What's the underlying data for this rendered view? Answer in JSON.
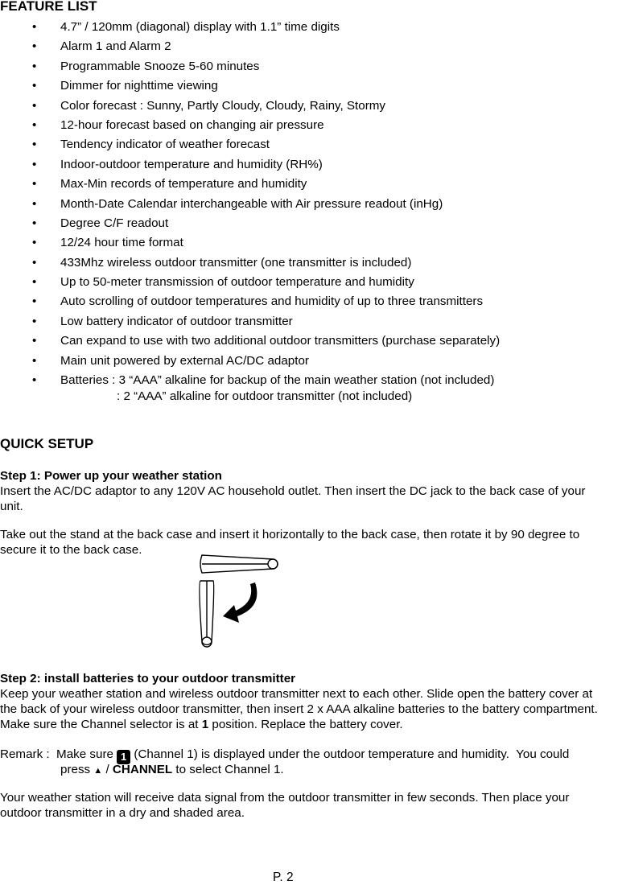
{
  "feature_list": {
    "title": "FEATURE LIST",
    "bullet_glyph": "•",
    "items": [
      "4.7” / 120mm (diagonal) display with 1.1” time digits",
      "Alarm 1 and Alarm 2",
      "Programmable Snooze 5-60 minutes",
      "Dimmer for nighttime viewing",
      "Color forecast : Sunny, Partly Cloudy, Cloudy, Rainy, Stormy",
      "12-hour forecast based on changing air pressure",
      "Tendency indicator of weather forecast",
      "Indoor-outdoor temperature and humidity (RH%)",
      "Max-Min records of temperature and humidity",
      "Month-Date Calendar interchangeable with Air pressure readout (inHg)",
      "Degree C/F readout",
      "12/24 hour time format",
      "433Mhz wireless outdoor transmitter (one transmitter is included)",
      "Up to 50-meter transmission of outdoor temperature and humidity",
      "Auto scrolling of outdoor temperatures and humidity of up to three transmitters",
      "Low battery indicator of outdoor transmitter",
      "Can expand to use with two additional outdoor transmitters (purchase separately)",
      "Main unit powered by external AC/DC adaptor"
    ],
    "batteries": {
      "line1": "Batteries : 3 “AAA” alkaline for backup of the main weather station (not included)",
      "line2": ": 2 “AAA” alkaline for outdoor transmitter (not included)"
    }
  },
  "quick_setup": {
    "title": "QUICK SETUP",
    "step1": {
      "heading": "Step 1: Power up your weather station",
      "para1_line1": "Insert the AC/DC adaptor to any 120V AC household outlet. Then insert the DC jack to the back case of your",
      "para1_line2": "unit.",
      "para2_line1": "Take out the stand at the back case and insert it horizontally to the back case, then rotate it by 90 degree to",
      "para2_line2": "secure it to the back case.",
      "figure_icon": "stand-rotation-illustration"
    },
    "step2": {
      "heading": "Step 2: install batteries to your outdoor transmitter",
      "line1": "Keep your weather station and wireless outdoor transmitter next to each other. Slide open the battery cover at",
      "line2": "the back of your wireless outdoor transmitter, then insert 2 x AAA alkaline batteries to the battery compartment.",
      "line3_pre": "Make sure the Channel selector is at ",
      "line3_bold": "1",
      "line3_post": " position. Replace the battery cover.",
      "remark_label": "Remark :  Make sure ",
      "remark_channel_icon": "1",
      "remark_line1_post": " (Channel 1) is displayed under the outdoor temperature and humidity.  You could",
      "remark_line2_pre": "press ",
      "remark_arrow": "▲",
      "remark_sep": " / ",
      "remark_bold": "CHANNEL",
      "remark_line2_post": " to select Channel 1.",
      "final_line1": "Your weather station will receive data signal from the outdoor transmitter in few seconds. Then place your",
      "final_line2": "outdoor transmitter in a dry and shaded area."
    }
  },
  "footer": {
    "page": "P. 2"
  }
}
